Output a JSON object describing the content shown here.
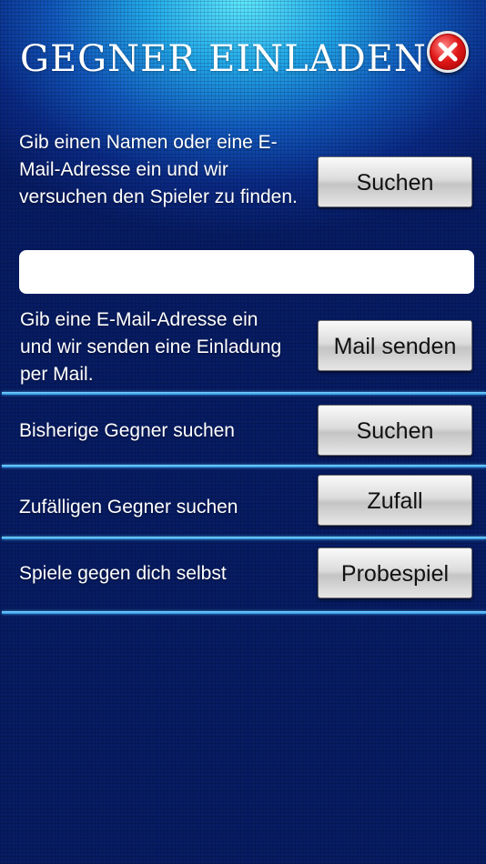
{
  "header": {
    "title": "GEGNER EINLADEN"
  },
  "search": {
    "description": "Gib einen Namen oder eine E-Mail-Adresse ein und wir versuchen den Spieler zu finden.",
    "button_label": "Suchen",
    "input_value": "",
    "input_placeholder": ""
  },
  "mail": {
    "description": "Gib eine E-Mail-Adresse ein und wir senden eine Einladung per Mail.",
    "button_label": "Mail senden"
  },
  "previous": {
    "label": "Bisherige Gegner suchen",
    "button_label": "Suchen"
  },
  "random": {
    "label": "Zufälligen Gegner suchen",
    "button_label": "Zufall"
  },
  "practice": {
    "label": "Spiele gegen dich selbst",
    "button_label": "Probespiel"
  },
  "colors": {
    "background": "#0a2a86",
    "accent": "#5ee8ff",
    "close": "#e01818"
  },
  "icons": {
    "close": "close-icon"
  }
}
